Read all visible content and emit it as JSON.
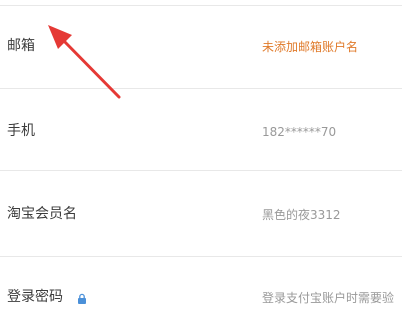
{
  "rows": [
    {
      "label": "邮箱",
      "value": "未添加邮箱账户名"
    },
    {
      "label": "手机",
      "value": "182******70"
    },
    {
      "label": "淘宝会员名",
      "value": "黑色的夜3312"
    },
    {
      "label": "登录密码",
      "value": "登录支付宝账户时需要验"
    }
  ],
  "colors": {
    "warning_text": "#e07a2a",
    "annotation_arrow": "#e53935"
  },
  "icons": {
    "password_lock": "lock-icon"
  }
}
